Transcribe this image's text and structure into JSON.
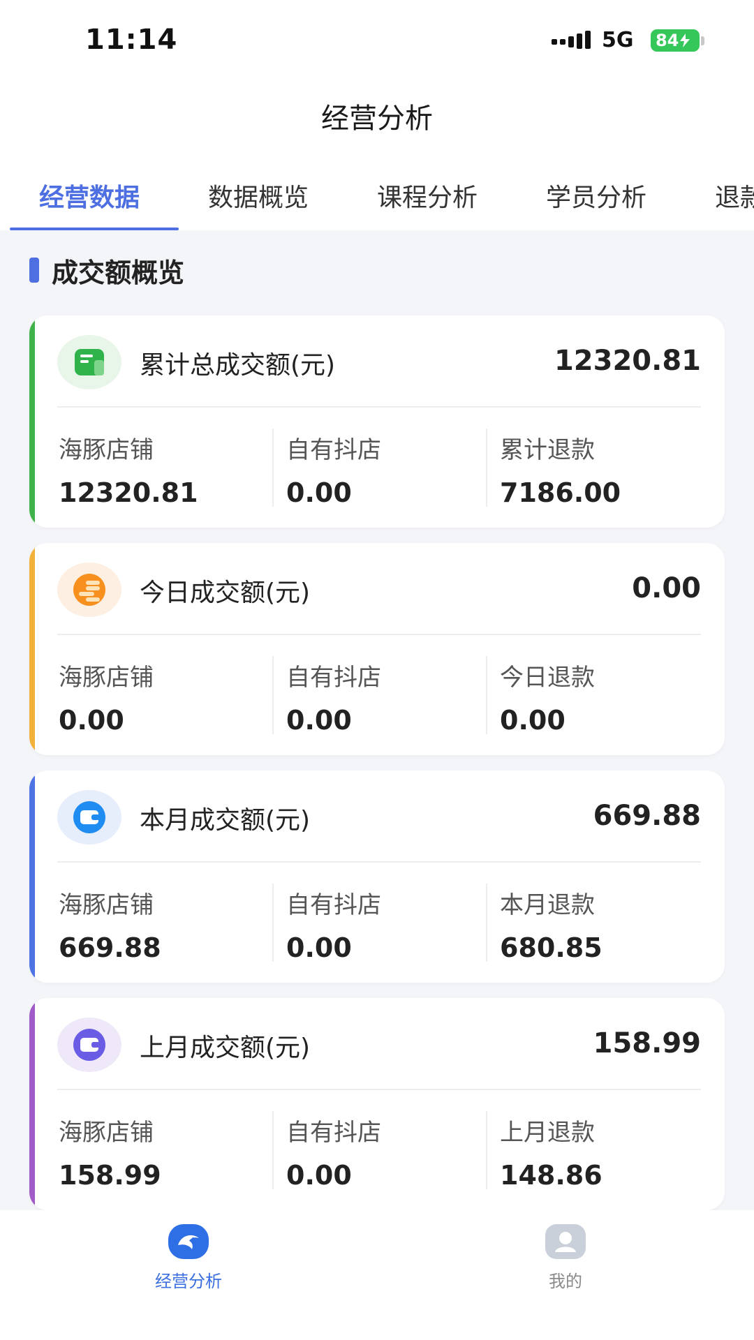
{
  "status_bar": {
    "time": "11:14",
    "network": "5G",
    "battery": "84"
  },
  "header": {
    "title": "经营分析"
  },
  "tabs": [
    {
      "label": "经营数据",
      "active": true
    },
    {
      "label": "数据概览",
      "active": false
    },
    {
      "label": "课程分析",
      "active": false
    },
    {
      "label": "学员分析",
      "active": false
    },
    {
      "label": "退款",
      "active": false
    }
  ],
  "section": {
    "title": "成交额概览"
  },
  "cards": [
    {
      "title": "累计总成交额(元)",
      "total": "12320.81",
      "accent": "#3fb24a",
      "icon": "ledger-icon",
      "cols": [
        {
          "label": "海豚店铺",
          "value": "12320.81"
        },
        {
          "label": "自有抖店",
          "value": "0.00"
        },
        {
          "label": "累计退款",
          "value": "7186.00"
        }
      ]
    },
    {
      "title": "今日成交额(元)",
      "total": "0.00",
      "accent": "#f2b23a",
      "icon": "coins-icon",
      "cols": [
        {
          "label": "海豚店铺",
          "value": "0.00"
        },
        {
          "label": "自有抖店",
          "value": "0.00"
        },
        {
          "label": "今日退款",
          "value": "0.00"
        }
      ]
    },
    {
      "title": "本月成交额(元)",
      "total": "669.88",
      "accent": "#4e74e4",
      "icon": "wallet-icon",
      "cols": [
        {
          "label": "海豚店铺",
          "value": "669.88"
        },
        {
          "label": "自有抖店",
          "value": "0.00"
        },
        {
          "label": "本月退款",
          "value": "680.85"
        }
      ]
    },
    {
      "title": "上月成交额(元)",
      "total": "158.99",
      "accent": "#a25cc8",
      "icon": "wallet-icon",
      "cols": [
        {
          "label": "海豚店铺",
          "value": "158.99"
        },
        {
          "label": "自有抖店",
          "value": "0.00"
        },
        {
          "label": "上月退款",
          "value": "148.86"
        }
      ]
    }
  ],
  "bottom_nav": [
    {
      "label": "经营分析",
      "icon": "dolphin-icon",
      "active": true
    },
    {
      "label": "我的",
      "icon": "profile-icon",
      "active": false
    }
  ]
}
